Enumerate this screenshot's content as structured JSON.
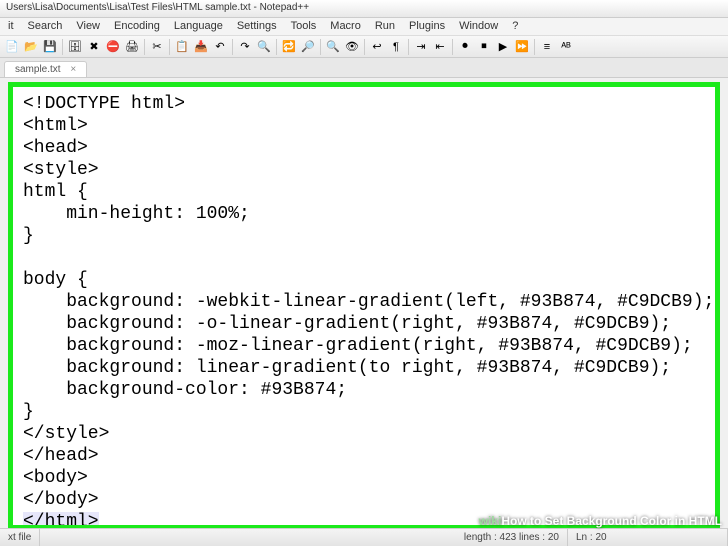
{
  "title": "Users\\Lisa\\Documents\\Lisa\\Test Files\\HTML sample.txt - Notepad++",
  "menu": [
    "it",
    "Search",
    "View",
    "Encoding",
    "Language",
    "Settings",
    "Tools",
    "Macro",
    "Run",
    "Plugins",
    "Window",
    "?"
  ],
  "toolbar_icons": [
    "new",
    "open",
    "save",
    "save-all",
    "close",
    "close-all",
    "print",
    "cut",
    "copy",
    "paste",
    "undo",
    "redo",
    "find",
    "replace",
    "zoom-in",
    "zoom-out",
    "sync",
    "word-wrap",
    "show-all",
    "indent",
    "outdent",
    "record",
    "stop",
    "play",
    "fast",
    "macro",
    "spell"
  ],
  "toolbar_glyphs": [
    "📄",
    "📂",
    "💾",
    "🗄",
    "✖",
    "⛔",
    "🖨",
    "✂",
    "📋",
    "📥",
    "↶",
    "↷",
    "🔍",
    "🔁",
    "🔎",
    "🔍",
    "👁",
    "↩",
    "¶",
    "⇥",
    "⇤",
    "⏺",
    "⏹",
    "▶",
    "⏩",
    "≡",
    "ᴬᴮ"
  ],
  "tab": {
    "label": "sample.txt"
  },
  "code_lines": [
    "<!DOCTYPE html>",
    "<html>",
    "<head>",
    "<style>",
    "html {",
    "    min-height: 100%;",
    "}",
    "",
    "body {",
    "    background: -webkit-linear-gradient(left, #93B874, #C9DCB9);",
    "    background: -o-linear-gradient(right, #93B874, #C9DCB9);",
    "    background: -moz-linear-gradient(right, #93B874, #C9DCB9);",
    "    background: linear-gradient(to right, #93B874, #C9DCB9);",
    "    background-color: #93B874;",
    "}",
    "</style>",
    "</head>",
    "<body>",
    "</body>"
  ],
  "code_last": "</html>",
  "status": {
    "type": "xt file",
    "length": "length : 423    lines : 20",
    "pos": "Ln : 20"
  },
  "watermark": {
    "brand": "wiki",
    "title": "How to Set Background Color in HTML"
  }
}
